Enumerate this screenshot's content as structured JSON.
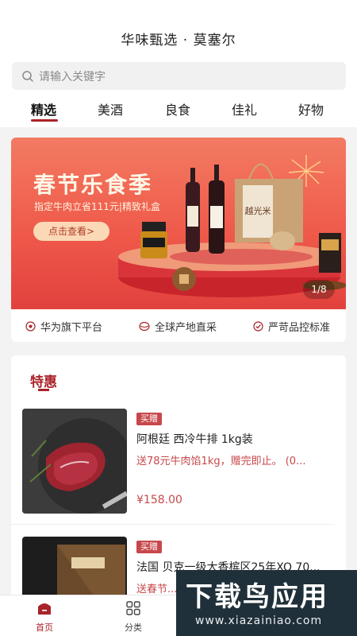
{
  "header": {
    "title": "华味甄选 · 莫塞尔",
    "search_placeholder": "请输入关键字"
  },
  "tabs": [
    {
      "label": "精选",
      "active": true
    },
    {
      "label": "美酒",
      "active": false
    },
    {
      "label": "良食",
      "active": false
    },
    {
      "label": "佳礼",
      "active": false
    },
    {
      "label": "好物",
      "active": false
    }
  ],
  "banner": {
    "title": "春节乐食季",
    "subtitle": "指定牛肉立省111元|精致礼盒",
    "button": "点击查看>",
    "pager": "1/8",
    "box_text": "越光米"
  },
  "features": [
    {
      "label": "华为旗下平台",
      "icon": "platform-icon"
    },
    {
      "label": "全球产地直采",
      "icon": "globe-icon"
    },
    {
      "label": "严苛品控标准",
      "icon": "check-icon"
    }
  ],
  "deals": {
    "title": "特惠",
    "items": [
      {
        "badge": "买赠",
        "name": "阿根廷 西冷牛排 1kg装",
        "promo": "送78元牛肉馅1kg，赠完即止。 (0...",
        "price": "¥158.00"
      },
      {
        "badge": "买赠",
        "name": "法国 贝克一级大香槟区25年XO 70...",
        "promo": "送春节..."
      }
    ]
  },
  "bottom_nav": [
    {
      "label": "首页",
      "active": true
    },
    {
      "label": "分类",
      "active": false
    }
  ],
  "watermark": {
    "logo": "下载鸟应用",
    "url": "www.xiazainiao.com"
  },
  "colors": {
    "accent": "#a9232a",
    "banner_red": "#ef5a4a",
    "price_red": "#c7484b"
  }
}
